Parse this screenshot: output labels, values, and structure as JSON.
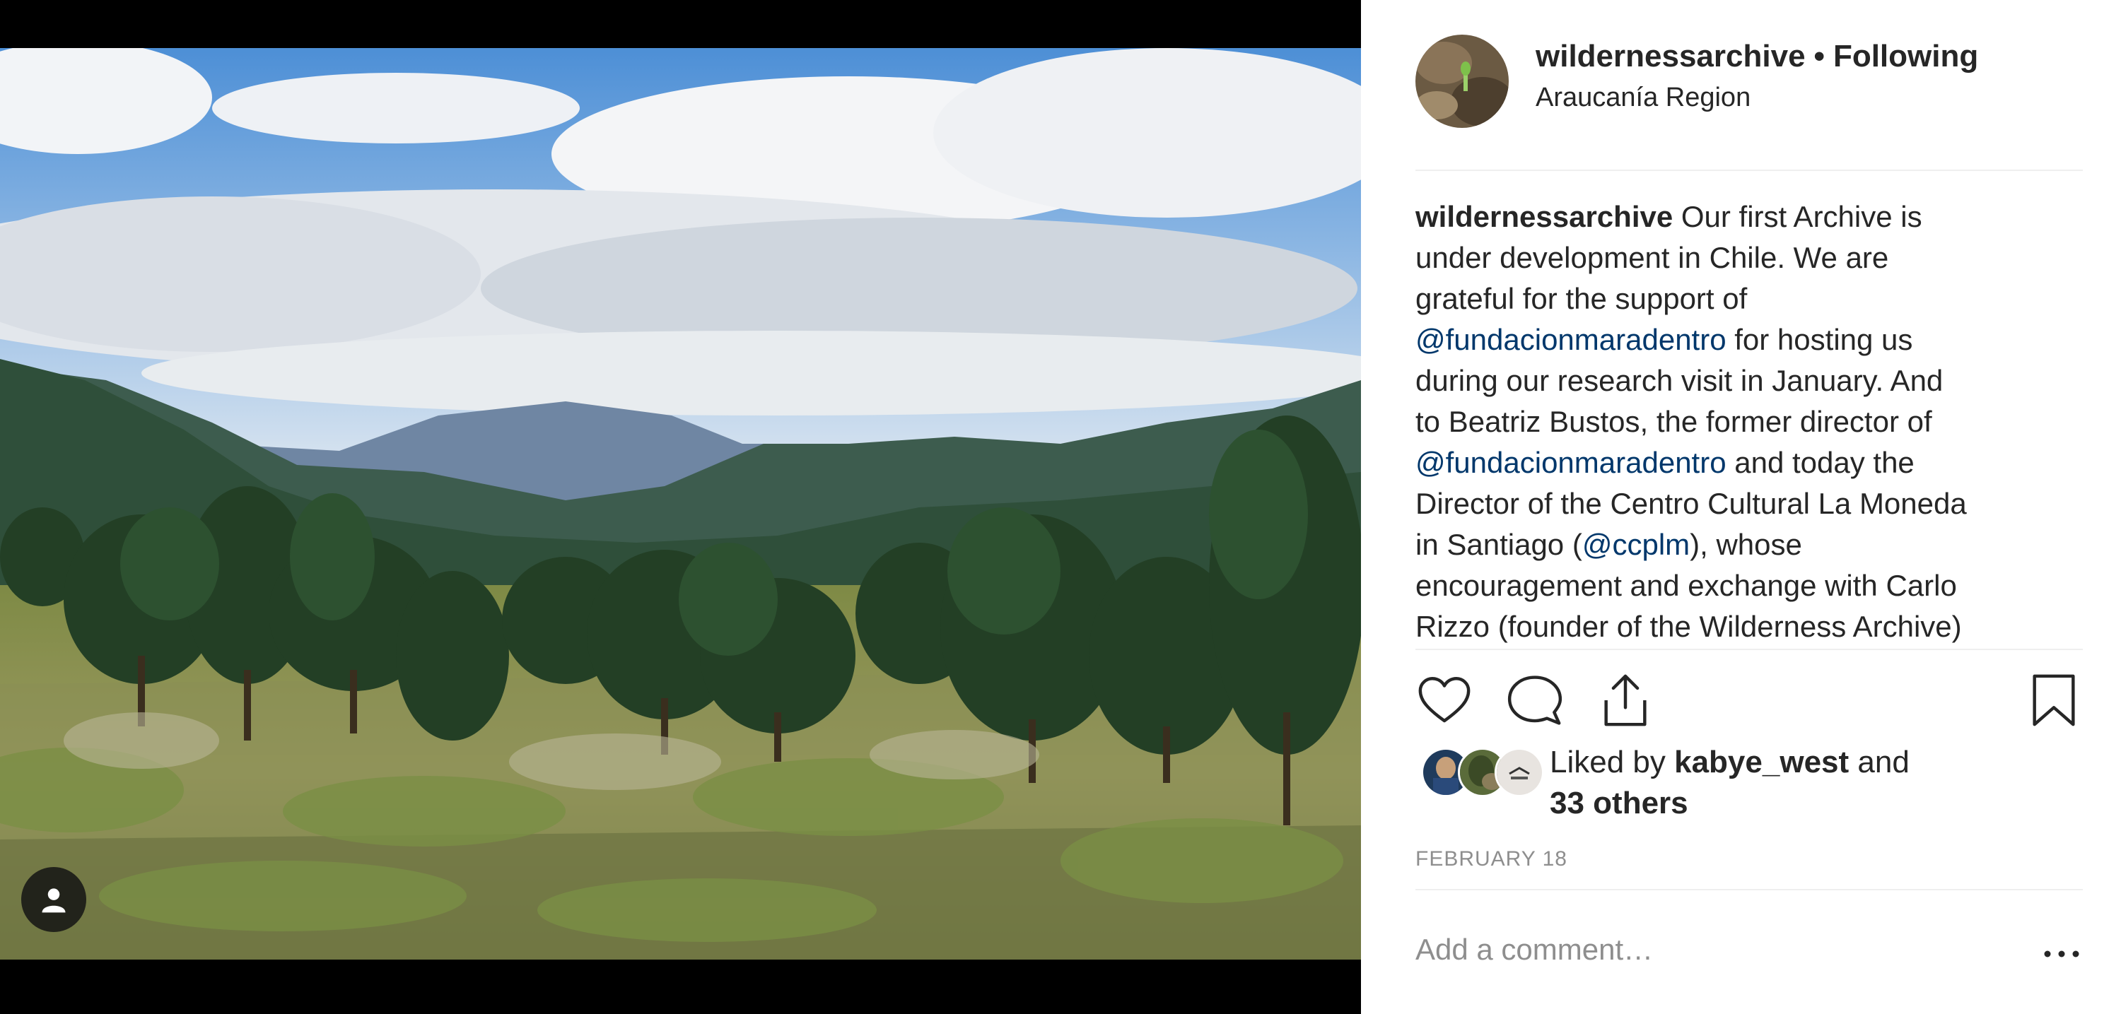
{
  "post": {
    "username": "wildernessarchive",
    "separator": "•",
    "follow_status": "Following",
    "location": "Araucanía Region"
  },
  "caption": {
    "username": "wildernessarchive",
    "line1_text": " Our first Archive is",
    "line2": "under development in Chile. We are",
    "line3": "grateful for the support of",
    "line4_mention": "@fundacionmaradentro",
    "line4_text": " for hosting us",
    "line5": "during our research visit in January. And",
    "line6": "to Beatriz Bustos, the former director of",
    "line7_mention": "@fundacionmaradentro",
    "line7_text": " and today the",
    "line8": "Director of the Centro Cultural La Moneda",
    "line9_pre": "in Santiago (",
    "line9_mention": "@ccplm",
    "line9_post": "), whose",
    "line10": "encouragement and exchange with Carlo",
    "line11": "Rizzo (founder of the Wilderness Archive)"
  },
  "likes": {
    "prefix": "Liked by ",
    "user": "kabye_west",
    "and": " and",
    "others": "33 others"
  },
  "date": "FEBRUARY 18",
  "comment": {
    "placeholder": "Add a comment…"
  },
  "icons": {
    "like": "heart-icon",
    "comment": "comment-icon",
    "share": "share-icon",
    "save": "bookmark-icon",
    "more": "more-options-icon",
    "tag": "user-tag-icon"
  },
  "colors": {
    "mention": "#00376b",
    "secondary_text": "#8e8e8e",
    "divider": "#efefef"
  }
}
